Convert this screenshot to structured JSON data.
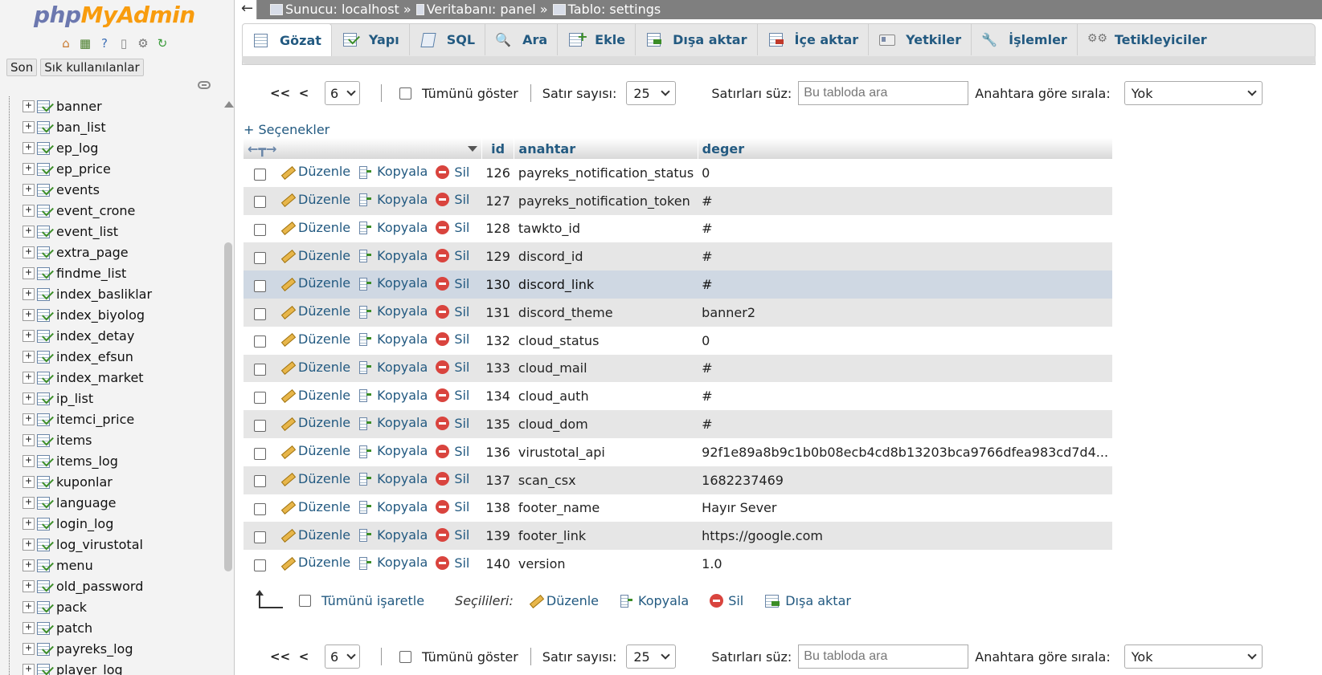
{
  "nav": {
    "logo_part1": "php",
    "logo_part2": "MyAdmin",
    "icons": [
      "home-icon",
      "database-icon",
      "help-icon",
      "docs-icon",
      "settings-icon",
      "reload-icon"
    ],
    "tab_recent": "Son",
    "tab_favorites": "Sık kullanılanlar",
    "tables": [
      "banner",
      "ban_list",
      "ep_log",
      "ep_price",
      "events",
      "event_crone",
      "event_list",
      "extra_page",
      "findme_list",
      "index_basliklar",
      "index_biyolog",
      "index_detay",
      "index_efsun",
      "index_market",
      "ip_list",
      "itemci_price",
      "items",
      "items_log",
      "kuponlar",
      "language",
      "login_log",
      "log_virustotal",
      "menu",
      "old_password",
      "pack",
      "patch",
      "payreks_log",
      "player_log"
    ]
  },
  "breadcrumb": {
    "server": "Sunucu: localhost »",
    "database": "Veritabanı: panel »",
    "table": "Tablo: settings"
  },
  "tabs": {
    "browse": "Gözat",
    "structure": "Yapı",
    "sql": "SQL",
    "search": "Ara",
    "insert": "Ekle",
    "export": "Dışa aktar",
    "import": "İçe aktar",
    "privileges": "Yetkiler",
    "operations": "İşlemler",
    "triggers": "Tetikleyiciler"
  },
  "navigation": {
    "first": "<<",
    "prev": "<",
    "page": "6",
    "show_all": "Tümünü göster",
    "rows_label": "Satır sayısı:",
    "rows_value": "25",
    "filter_label": "Satırları süz:",
    "filter_placeholder": "Bu tabloda ara",
    "sort_label": "Anahtara göre sırala:",
    "sort_value": "Yok"
  },
  "options_link": "+ Seçenekler",
  "table": {
    "headers": [
      "id",
      "anahtar",
      "deger"
    ],
    "action_edit": "Düzenle",
    "action_copy": "Kopyala",
    "action_delete": "Sil",
    "rows": [
      {
        "id": "126",
        "anahtar": "payreks_notification_status",
        "deger": "0"
      },
      {
        "id": "127",
        "anahtar": "payreks_notification_token",
        "deger": "#"
      },
      {
        "id": "128",
        "anahtar": "tawkto_id",
        "deger": "#"
      },
      {
        "id": "129",
        "anahtar": "discord_id",
        "deger": "#"
      },
      {
        "id": "130",
        "anahtar": "discord_link",
        "deger": "#"
      },
      {
        "id": "131",
        "anahtar": "discord_theme",
        "deger": "banner2"
      },
      {
        "id": "132",
        "anahtar": "cloud_status",
        "deger": "0"
      },
      {
        "id": "133",
        "anahtar": "cloud_mail",
        "deger": "#"
      },
      {
        "id": "134",
        "anahtar": "cloud_auth",
        "deger": "#"
      },
      {
        "id": "135",
        "anahtar": "cloud_dom",
        "deger": "#"
      },
      {
        "id": "136",
        "anahtar": "virustotal_api",
        "deger": "92f1e89a8b9c1b0b08ecb4cd8b13203bca9766dfea983cd7d4..."
      },
      {
        "id": "137",
        "anahtar": "scan_csx",
        "deger": "1682237469"
      },
      {
        "id": "138",
        "anahtar": "footer_name",
        "deger": "Hayır Sever"
      },
      {
        "id": "139",
        "anahtar": "footer_link",
        "deger": "https://google.com"
      },
      {
        "id": "140",
        "anahtar": "version",
        "deger": "1.0"
      }
    ]
  },
  "bulk": {
    "check_all": "Tümünü işaretle",
    "with_selected": "Seçilileri:",
    "edit": "Düzenle",
    "copy": "Kopyala",
    "delete": "Sil",
    "export": "Dışa aktar"
  }
}
